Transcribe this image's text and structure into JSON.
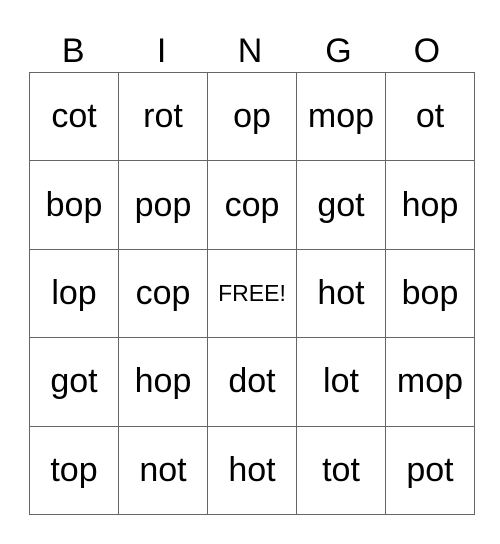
{
  "header": [
    "B",
    "I",
    "N",
    "G",
    "O"
  ],
  "grid": [
    [
      "cot",
      "rot",
      "op",
      "mop",
      "ot"
    ],
    [
      "bop",
      "pop",
      "cop",
      "got",
      "hop"
    ],
    [
      "lop",
      "cop",
      "FREE!",
      "hot",
      "bop"
    ],
    [
      "got",
      "hop",
      "dot",
      "lot",
      "mop"
    ],
    [
      "top",
      "not",
      "hot",
      "tot",
      "pot"
    ]
  ],
  "free_space": {
    "row": 2,
    "col": 2,
    "label": "FREE!"
  }
}
